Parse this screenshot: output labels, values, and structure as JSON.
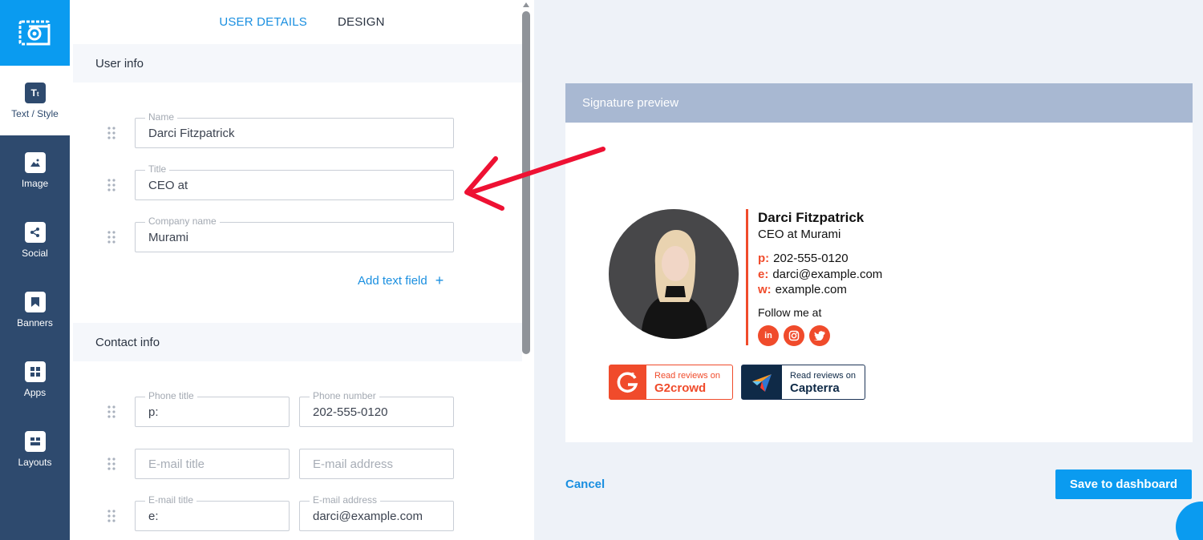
{
  "rail": {
    "logo_icon": "envelope-at-logo",
    "items": [
      {
        "label": "Text / Style",
        "icon": "text-style-icon",
        "active": true
      },
      {
        "label": "Image",
        "icon": "image-icon",
        "active": false
      },
      {
        "label": "Social",
        "icon": "share-icon",
        "active": false
      },
      {
        "label": "Banners",
        "icon": "bookmark-icon",
        "active": false
      },
      {
        "label": "Apps",
        "icon": "grid-icon",
        "active": false
      },
      {
        "label": "Layouts",
        "icon": "layout-icon",
        "active": false
      }
    ]
  },
  "editor": {
    "tabs": [
      {
        "label": "USER DETAILS",
        "active": true
      },
      {
        "label": "DESIGN",
        "active": false
      }
    ],
    "user_info": {
      "header": "User info",
      "fields": [
        {
          "label": "Name",
          "value": "Darci Fitzpatrick"
        },
        {
          "label": "Title",
          "value": "CEO at"
        },
        {
          "label": "Company name",
          "value": "Murami"
        }
      ],
      "add_text_field": "Add text field",
      "add_symbol": "+"
    },
    "contact_info": {
      "header": "Contact info",
      "rows": [
        {
          "title_label": "Phone title",
          "title_value": "p:",
          "value_label": "Phone number",
          "value": "202-555-0120"
        },
        {
          "title_placeholder": "E-mail title",
          "value_placeholder": "E-mail address"
        },
        {
          "title_label": "E-mail title",
          "title_value": "e:",
          "value_label": "E-mail address",
          "value": "darci@example.com"
        }
      ]
    }
  },
  "preview": {
    "header": "Signature preview",
    "name": "Darci Fitzpatrick",
    "title_line": "CEO at Murami",
    "contacts": [
      {
        "key": "p:",
        "value": "202-555-0120"
      },
      {
        "key": "e:",
        "value": "darci@example.com"
      },
      {
        "key": "w:",
        "value": "example.com"
      }
    ],
    "follow_text": "Follow me at",
    "socials": [
      {
        "icon": "linkedin-icon",
        "glyph": "in"
      },
      {
        "icon": "instagram-icon",
        "glyph": "◎"
      },
      {
        "icon": "twitter-icon",
        "glyph": "🐦"
      }
    ],
    "badges": [
      {
        "small": "Read reviews on",
        "big": "G2crowd",
        "logo": "G2"
      },
      {
        "small": "Read reviews on",
        "big": "Capterra",
        "logo": ""
      }
    ]
  },
  "actions": {
    "cancel": "Cancel",
    "save": "Save to dashboard"
  },
  "colors": {
    "accent": "#0a9bf0",
    "rail": "#2e4a6e",
    "signature_accent": "#f04b2b",
    "annotation_arrow": "#ee1133"
  }
}
